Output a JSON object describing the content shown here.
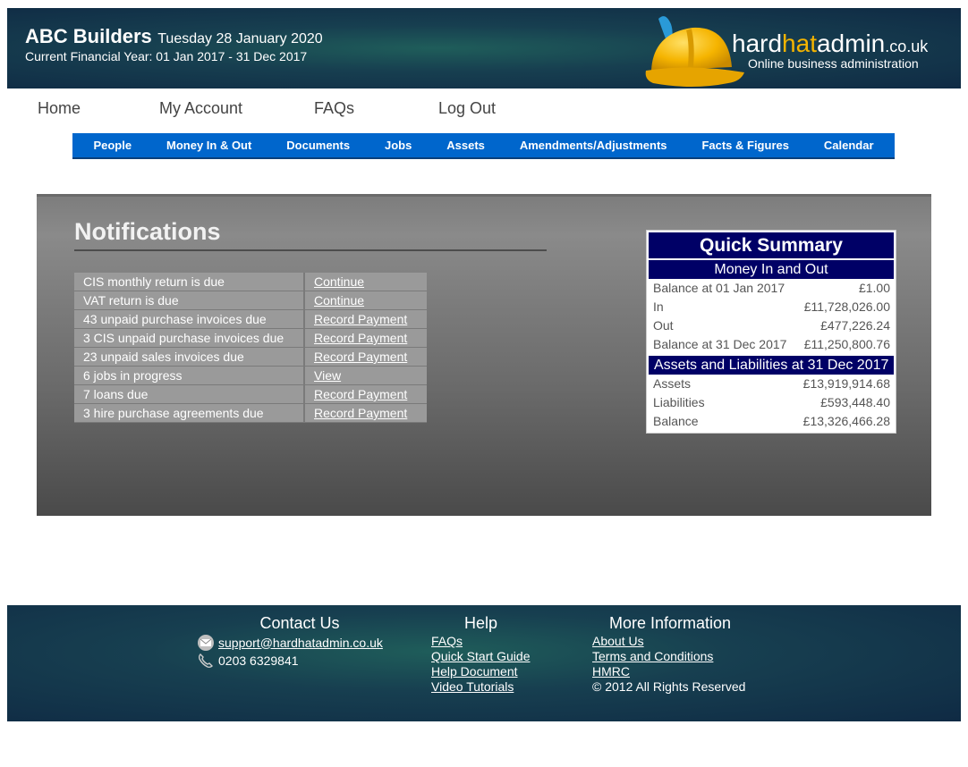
{
  "header": {
    "company_name": "ABC Builders",
    "date": "Tuesday 28 January 2020",
    "financial_year": "Current Financial Year: 01 Jan 2017 - 31 Dec 2017",
    "logo": {
      "part1": "hard",
      "part2": "hat",
      "part3": "admin",
      "tld": ".co.uk",
      "tagline": "Online business administration"
    }
  },
  "topnav": [
    "Home",
    "My Account",
    "FAQs",
    "Log Out"
  ],
  "menu": [
    "People",
    "Money In & Out",
    "Documents",
    "Jobs",
    "Assets",
    "Amendments/Adjustments",
    "Facts & Figures",
    "Calendar"
  ],
  "notifications": {
    "title": "Notifications",
    "items": [
      {
        "label": "CIS monthly return is due",
        "action": "Continue"
      },
      {
        "label": "VAT return is due",
        "action": "Continue"
      },
      {
        "label": "43 unpaid purchase invoices due",
        "action": "Record Payment"
      },
      {
        "label": "3 CIS unpaid purchase invoices due",
        "action": "Record Payment"
      },
      {
        "label": "23 unpaid sales invoices due",
        "action": "Record Payment"
      },
      {
        "label": "6 jobs in progress",
        "action": "View"
      },
      {
        "label": "7 loans due",
        "action": "Record Payment"
      },
      {
        "label": "3 hire purchase agreements due",
        "action": "Record Payment"
      }
    ]
  },
  "quick_summary": {
    "title": "Quick Summary",
    "money_heading": "Money In and Out",
    "money_rows": [
      {
        "label": "Balance at 01 Jan 2017",
        "value": "£1.00"
      },
      {
        "label": "In",
        "value": "£11,728,026.00"
      },
      {
        "label": "Out",
        "value": "£477,226.24"
      },
      {
        "label": "Balance at 31 Dec 2017",
        "value": "£11,250,800.76"
      }
    ],
    "assets_heading": "Assets and Liabilities at 31 Dec 2017",
    "assets_rows": [
      {
        "label": "Assets",
        "value": "£13,919,914.68"
      },
      {
        "label": "Liabilities",
        "value": "£593,448.40"
      },
      {
        "label": "Balance",
        "value": "£13,326,466.28"
      }
    ]
  },
  "footer": {
    "contact": {
      "title": "Contact Us",
      "email": "support@hardhatadmin.co.uk",
      "phone": "0203 6329841"
    },
    "help": {
      "title": "Help",
      "links": [
        "FAQs",
        "Quick Start Guide",
        "Help Document",
        "Video Tutorials"
      ]
    },
    "more": {
      "title": "More Information",
      "links": [
        "About Us",
        "Terms and Conditions",
        "HMRC"
      ],
      "copyright": "© 2012 All Rights Reserved"
    }
  },
  "colors": {
    "menu_bg": "#0066cc",
    "summary_heading_bg": "#000066",
    "logo_accent": "#f5b400"
  }
}
